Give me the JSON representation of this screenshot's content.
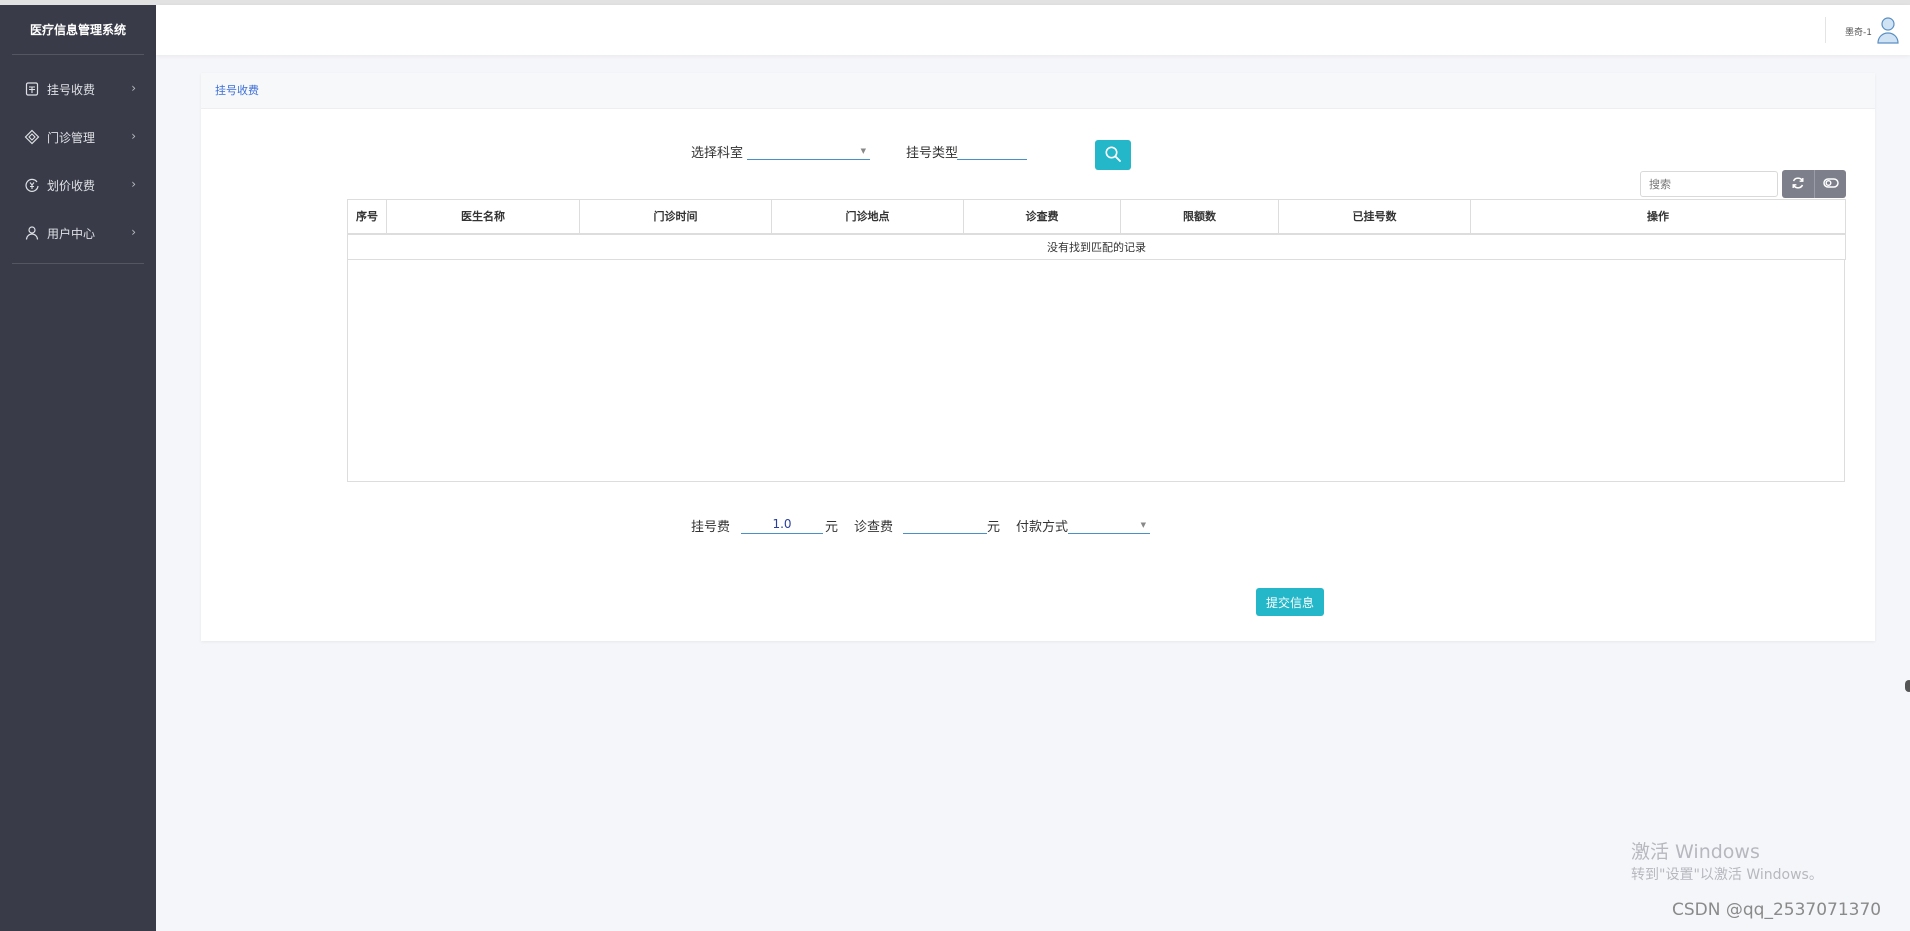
{
  "app": {
    "title": "医疗信息管理系统"
  },
  "sidebar": {
    "items": [
      {
        "label": "挂号收费",
        "icon": "register-fee-icon"
      },
      {
        "label": "门诊管理",
        "icon": "diamond-icon"
      },
      {
        "label": "划价收费",
        "icon": "pricing-icon"
      },
      {
        "label": "用户中心",
        "icon": "user-icon"
      }
    ]
  },
  "header": {
    "user_name": "墨奇-1"
  },
  "panel": {
    "title": "挂号收费",
    "filters": {
      "department_label": "选择科室",
      "department_value": "",
      "reg_type_label": "挂号类型",
      "reg_type_value": ""
    },
    "toolbar": {
      "search_placeholder": "搜索"
    },
    "table": {
      "columns": [
        "序号",
        "医生名称",
        "门诊时间",
        "门诊地点",
        "诊查费",
        "限额数",
        "已挂号数",
        "操作"
      ],
      "empty_text": "没有找到匹配的记录"
    },
    "fees": {
      "reg_fee_label": "挂号费",
      "reg_fee_value": "1.0",
      "reg_fee_unit": "元",
      "exam_fee_label": "诊查费",
      "exam_fee_value": "",
      "exam_fee_unit": "元",
      "payment_label": "付款方式",
      "payment_value": ""
    },
    "submit_label": "提交信息"
  },
  "overlay": {
    "activate_title": "激活 Windows",
    "activate_sub": "转到\"设置\"以激活 Windows。",
    "csdn": "CSDN @qq_2537071370"
  },
  "colors": {
    "sidebar": "#393b48",
    "accent": "#23b7c9",
    "link": "#3c6fd8"
  }
}
